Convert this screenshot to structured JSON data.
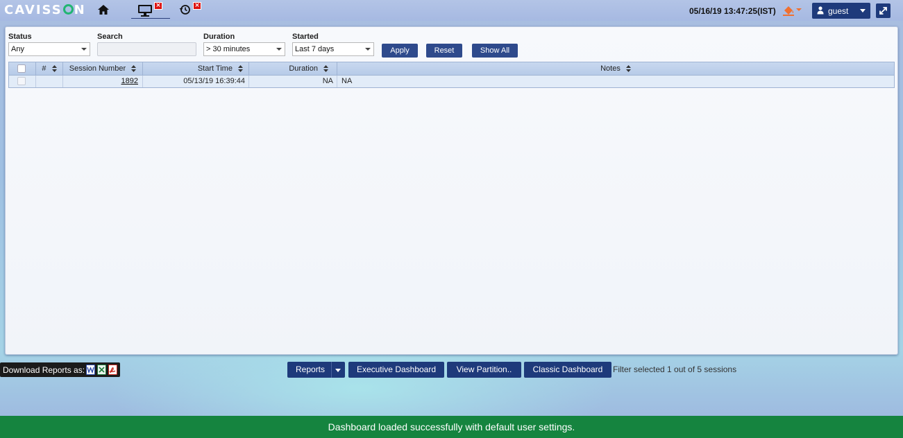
{
  "header": {
    "logo_text": "CAVISSON",
    "datetime": "05/16/19 13:47:25(IST)",
    "user_name": "guest",
    "close_badge": "×"
  },
  "filters": {
    "status": {
      "label": "Status",
      "value": "Any"
    },
    "search": {
      "label": "Search",
      "value": ""
    },
    "duration": {
      "label": "Duration",
      "value": "> 30 minutes"
    },
    "started": {
      "label": "Started",
      "value": "Last 7 days"
    },
    "apply_label": "Apply",
    "reset_label": "Reset",
    "show_all_label": "Show All"
  },
  "table": {
    "columns": [
      "#",
      "Session Number",
      "Start Time",
      "Duration",
      "Notes"
    ],
    "rows": [
      {
        "index": "",
        "session_number": "1892",
        "start_time": "05/13/19 16:39:44",
        "duration": "NA",
        "notes": "NA"
      }
    ]
  },
  "footer": {
    "download_label": "Download Reports as:",
    "reports_label": "Reports",
    "executive_label": "Executive Dashboard",
    "partition_label": "View Partition..",
    "classic_label": "Classic Dashboard",
    "filter_status": "Filter selected 1 out of 5 sessions"
  },
  "toast": {
    "message": "Dashboard loaded successfully with default user settings."
  },
  "colors": {
    "primary_button": "#1e3a7b",
    "toast_success": "#15843f",
    "logo_accent": "#22b573",
    "close_badge": "#dd1111"
  }
}
